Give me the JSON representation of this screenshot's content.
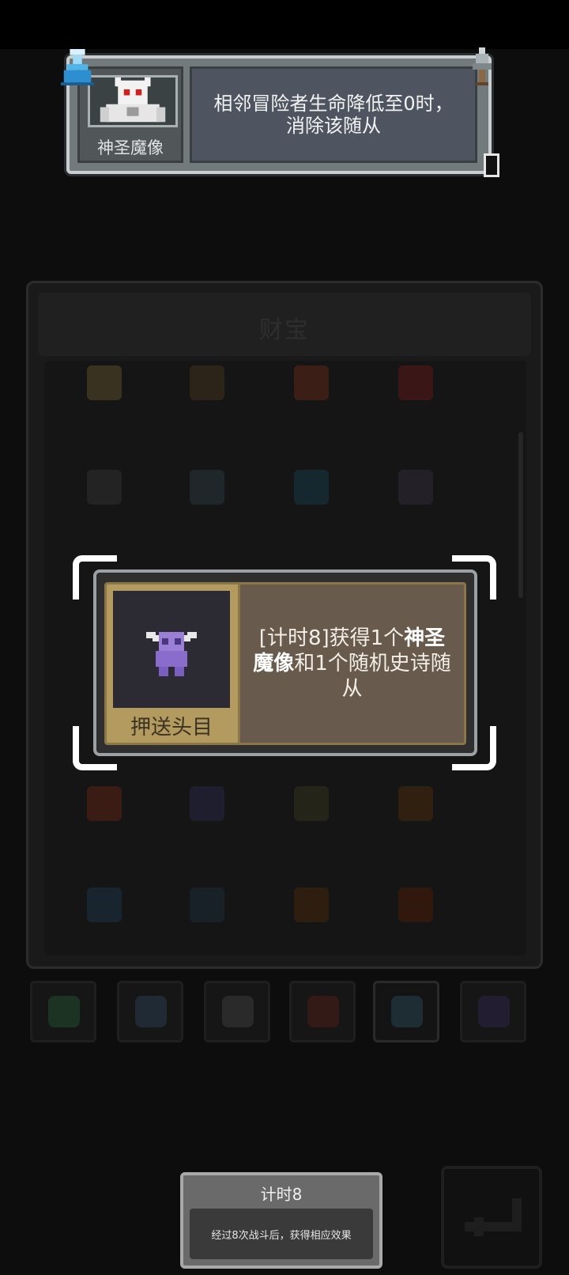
{
  "info_card": {
    "name": "神圣魔像",
    "description": "相邻冒险者生命降低至0时，消除该随从"
  },
  "treasure": {
    "title": "财宝",
    "items": [
      {
        "icon": "crossed-swords-icon",
        "color": "#3a3220"
      },
      {
        "icon": "pickaxe-icon",
        "color": "#2c2418"
      },
      {
        "icon": "shield-orb-icon",
        "color": "#3b1e16"
      },
      {
        "icon": "chest-icon",
        "color": "#3a1616"
      },
      {
        "icon": "phone-icon",
        "color": "#232323"
      },
      {
        "icon": "axe-icon",
        "color": "#20272a"
      },
      {
        "icon": "crystal-ball-icon",
        "color": "#152830"
      },
      {
        "icon": "spider-icon",
        "color": "#232028"
      },
      {
        "icon": "scroll-icon",
        "color": "#3a1c14"
      },
      {
        "icon": "helmet-icon",
        "color": "#1e1e2e"
      },
      {
        "icon": "lamp-icon",
        "color": "#242418"
      },
      {
        "icon": "spear-icon",
        "color": "#30200f"
      },
      {
        "icon": "blade-icon",
        "color": "#18252e"
      },
      {
        "icon": "wing-icon",
        "color": "#182028"
      },
      {
        "icon": "fire-icon",
        "color": "#2e1e10"
      },
      {
        "icon": "heart-box-icon",
        "color": "#30180f"
      }
    ]
  },
  "tabs": [
    {
      "name": "tab-clover",
      "icon": "clover-icon",
      "color": "#1c3323"
    },
    {
      "name": "tab-potion",
      "icon": "potion-icon",
      "color": "#1f2a35"
    },
    {
      "name": "tab-bone",
      "icon": "bone-icon",
      "color": "#2a2a2a"
    },
    {
      "name": "tab-cat",
      "icon": "cat-mask-icon",
      "color": "#331a16"
    },
    {
      "name": "tab-diamond-blue",
      "icon": "diamond-icon",
      "color": "#1d2d33",
      "active": true
    },
    {
      "name": "tab-diamond-purple",
      "icon": "diamond-icon",
      "color": "#221d30"
    }
  ],
  "popup": {
    "name": "押送头目",
    "desc_prefix": "[计时8]获得1个",
    "desc_bold": "神圣魔像",
    "desc_suffix": "和1个随机史诗随从",
    "accent": "#b39b5f"
  },
  "timer": {
    "title": "计时8",
    "body": "经过8次战斗后，获得相应效果"
  }
}
